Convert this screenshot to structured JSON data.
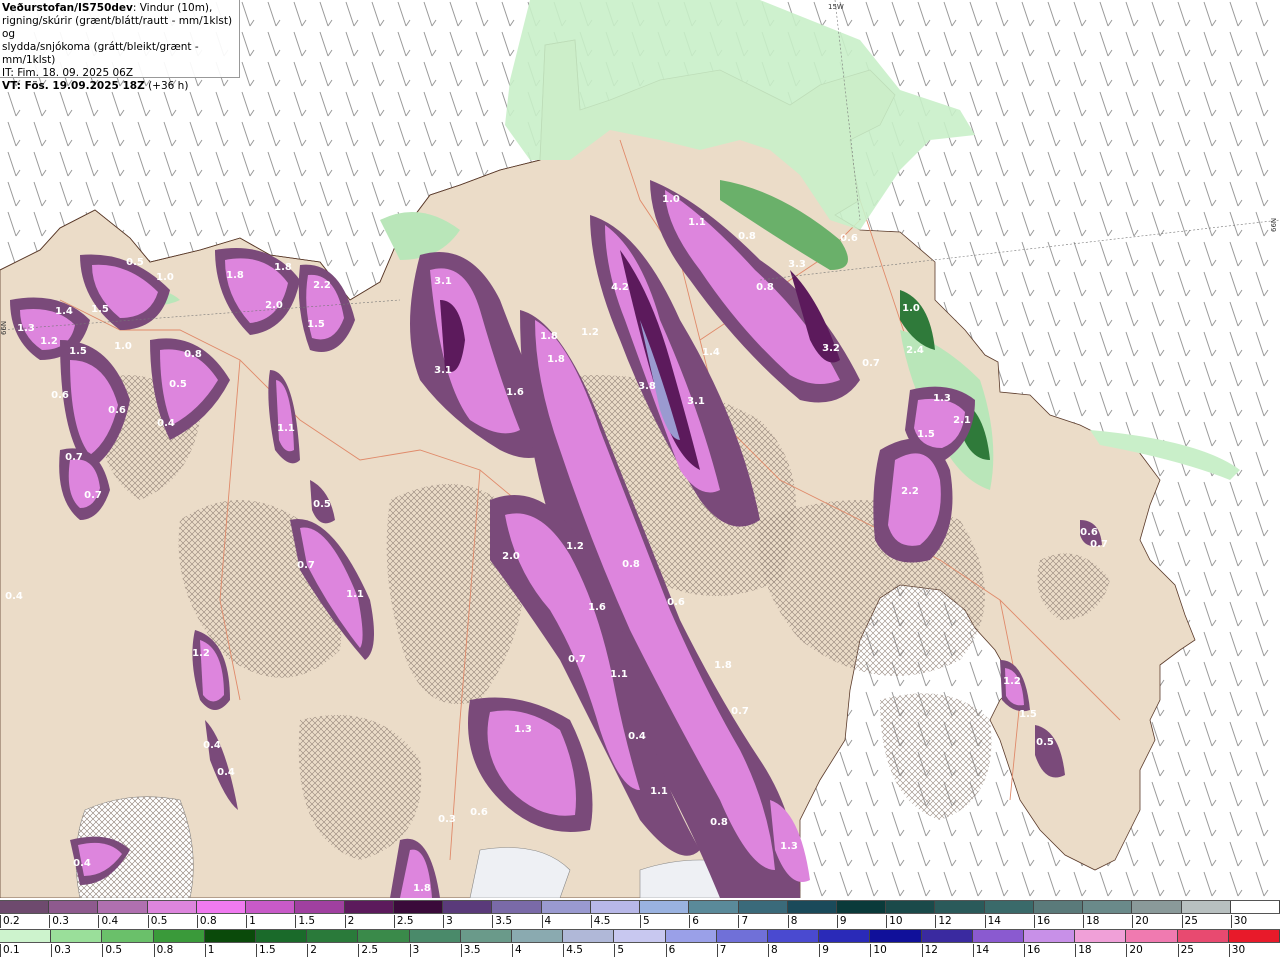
{
  "header": {
    "model": "Veðurstofan/IS750dev",
    "description_line1": ": Vindur (10m),",
    "description_line2": "rigning/skúrir (grænt/blátt/rautt - mm/1klst) og",
    "description_line3": "slydda/snjókoma (grátt/bleikt/grænt - mm/1klst)",
    "init_time": "IT: Fim. 18. 09. 2025 06Z",
    "valid_prefix": "VT: Fös. 19.09.2025 18Z",
    "valid_offset": " (+36 h)"
  },
  "grid_labels": [
    "15W",
    "66N",
    "66N"
  ],
  "precip_labels": [
    "0.5",
    "1.0",
    "1.8",
    "1.8",
    "2.2",
    "1.3",
    "1.4",
    "1.5",
    "1.2",
    "1.5",
    "1.0",
    "2.0",
    "1.5",
    "0.8",
    "0.6",
    "0.6",
    "0.5",
    "0.4",
    "1.1",
    "0.7",
    "0.7",
    "3.1",
    "3.1",
    "1.6",
    "1.8",
    "1.8",
    "4.2",
    "1.2",
    "3.8",
    "3.1",
    "1.4",
    "1.0",
    "1.1",
    "0.8",
    "0.8",
    "3.3",
    "3.2",
    "1.0",
    "2.4",
    "0.6",
    "0.7",
    "1.3",
    "2.1",
    "1.5",
    "2.2",
    "2.0",
    "1.2",
    "1.6",
    "0.8",
    "0.6",
    "0.7",
    "1.1",
    "1.8",
    "0.7",
    "1.3",
    "0.4",
    "1.1",
    "0.8",
    "1.3",
    "0.3",
    "0.6",
    "1.8",
    "1.2",
    "0.4",
    "0.4",
    "0.4",
    "0.7",
    "0.5",
    "1.1",
    "1.2",
    "1.5",
    "0.5",
    "0.6",
    "0.7",
    "0.4"
  ],
  "scale_snow": {
    "ticks": [
      "0.2",
      "0.3",
      "0.4",
      "0.5",
      "0.8",
      "1",
      "1.5",
      "2",
      "2.5",
      "3",
      "3.5",
      "4",
      "4.5",
      "5",
      "6",
      "7",
      "8",
      "9",
      "10",
      "12",
      "14",
      "16",
      "18",
      "20",
      "25",
      "30"
    ],
    "colors": [
      "#6e4a6e",
      "#8e5a8e",
      "#b070b0",
      "#dd85dd",
      "#f07af0",
      "#c85ac8",
      "#a040a0",
      "#5c1a5c",
      "#3a0a3a",
      "#5a3a7a",
      "#7a6aa8",
      "#9a9ad0",
      "#b8b8e8",
      "#9ab2e0",
      "#5a8a9a",
      "#3a6a7a",
      "#1a4a5a",
      "#0a3a3a",
      "#1a4a4a",
      "#2a5a5a",
      "#3a6a6a",
      "#5a7a7a",
      "#6a8a8a",
      "#8a9a9a",
      "#b8c0c0",
      "#ffffff"
    ]
  },
  "scale_rain": {
    "ticks": [
      "0.1",
      "0.3",
      "0.5",
      "0.8",
      "1",
      "1.5",
      "2",
      "2.5",
      "3",
      "3.5",
      "4",
      "4.5",
      "5",
      "6",
      "7",
      "8",
      "9",
      "10",
      "12",
      "14",
      "16",
      "18",
      "20",
      "25",
      "30"
    ],
    "colors": [
      "#cdf3cd",
      "#9adf9a",
      "#6ac06a",
      "#3a9a3a",
      "#0a4a0a",
      "#1a6a2a",
      "#2a7a3a",
      "#3a8a4a",
      "#4a8a6a",
      "#6a9a8a",
      "#8aaab0",
      "#b0b8d8",
      "#c8c8f0",
      "#9aa0e8",
      "#7070d8",
      "#4a4ad0",
      "#2a2ab8",
      "#10109a",
      "#3a2aa0",
      "#8a5ad0",
      "#c890e8",
      "#f0a0d8",
      "#f07ab0",
      "#e84a70",
      "#e81a2a"
    ]
  }
}
